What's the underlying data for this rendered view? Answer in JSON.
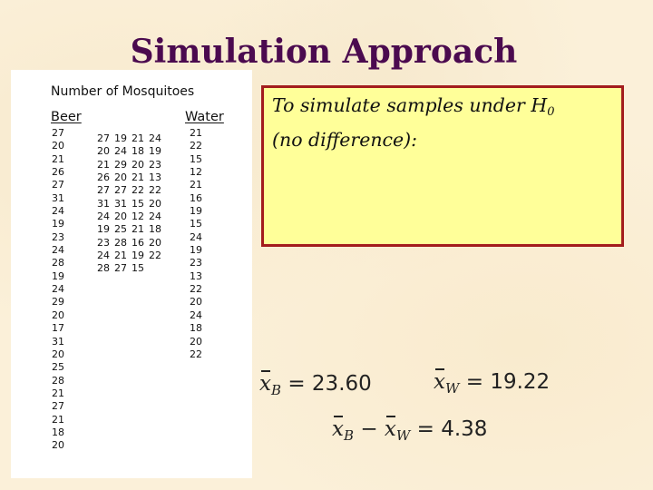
{
  "slide": {
    "title": "Simulation Approach"
  },
  "data_panel": {
    "heading": "Number of Mosquitoes",
    "beer_label": "Beer",
    "water_label": "Water",
    "beer_values": [
      "27",
      "20",
      "21",
      "26",
      "27",
      "31",
      "24",
      "19",
      "23",
      "24",
      "28",
      "19",
      "24",
      "29",
      "20",
      "17",
      "31",
      "20",
      "25",
      "28",
      "21",
      "27",
      "21",
      "18",
      "20"
    ],
    "water_values": [
      "21",
      "22",
      "15",
      "12",
      "21",
      "16",
      "19",
      "15",
      "24",
      "19",
      "23",
      "13",
      "22",
      "20",
      "24",
      "18",
      "20",
      "22"
    ],
    "combined_grid": [
      [
        "27",
        "19",
        "21",
        "24"
      ],
      [
        "20",
        "24",
        "18",
        "19"
      ],
      [
        "21",
        "29",
        "20",
        "23"
      ],
      [
        "26",
        "20",
        "21",
        "13"
      ],
      [
        "27",
        "27",
        "22",
        "22"
      ],
      [
        "31",
        "31",
        "15",
        "20"
      ],
      [
        "24",
        "20",
        "12",
        "24"
      ],
      [
        "19",
        "25",
        "21",
        "18"
      ],
      [
        "23",
        "28",
        "16",
        "20"
      ],
      [
        "24",
        "21",
        "19",
        "22"
      ],
      [
        "28",
        "27",
        "15",
        ""
      ]
    ]
  },
  "hypothesis_box": {
    "line1": "To simulate samples under H",
    "subscript": "0",
    "line2": "(no difference):"
  },
  "stats": {
    "mean_beer": {
      "symbol": "x",
      "sub": "B",
      "value": "23.60"
    },
    "mean_water": {
      "symbol": "x",
      "sub": "W",
      "value": "19.22"
    },
    "difference": {
      "sub_a": "B",
      "sub_b": "W",
      "value": "4.38"
    },
    "equals": "=",
    "minus": "−"
  },
  "colors": {
    "title": "#4b0a4f",
    "box_fill": "#ffff99",
    "box_border": "#a31d1d",
    "background": "#fbf0d9"
  }
}
